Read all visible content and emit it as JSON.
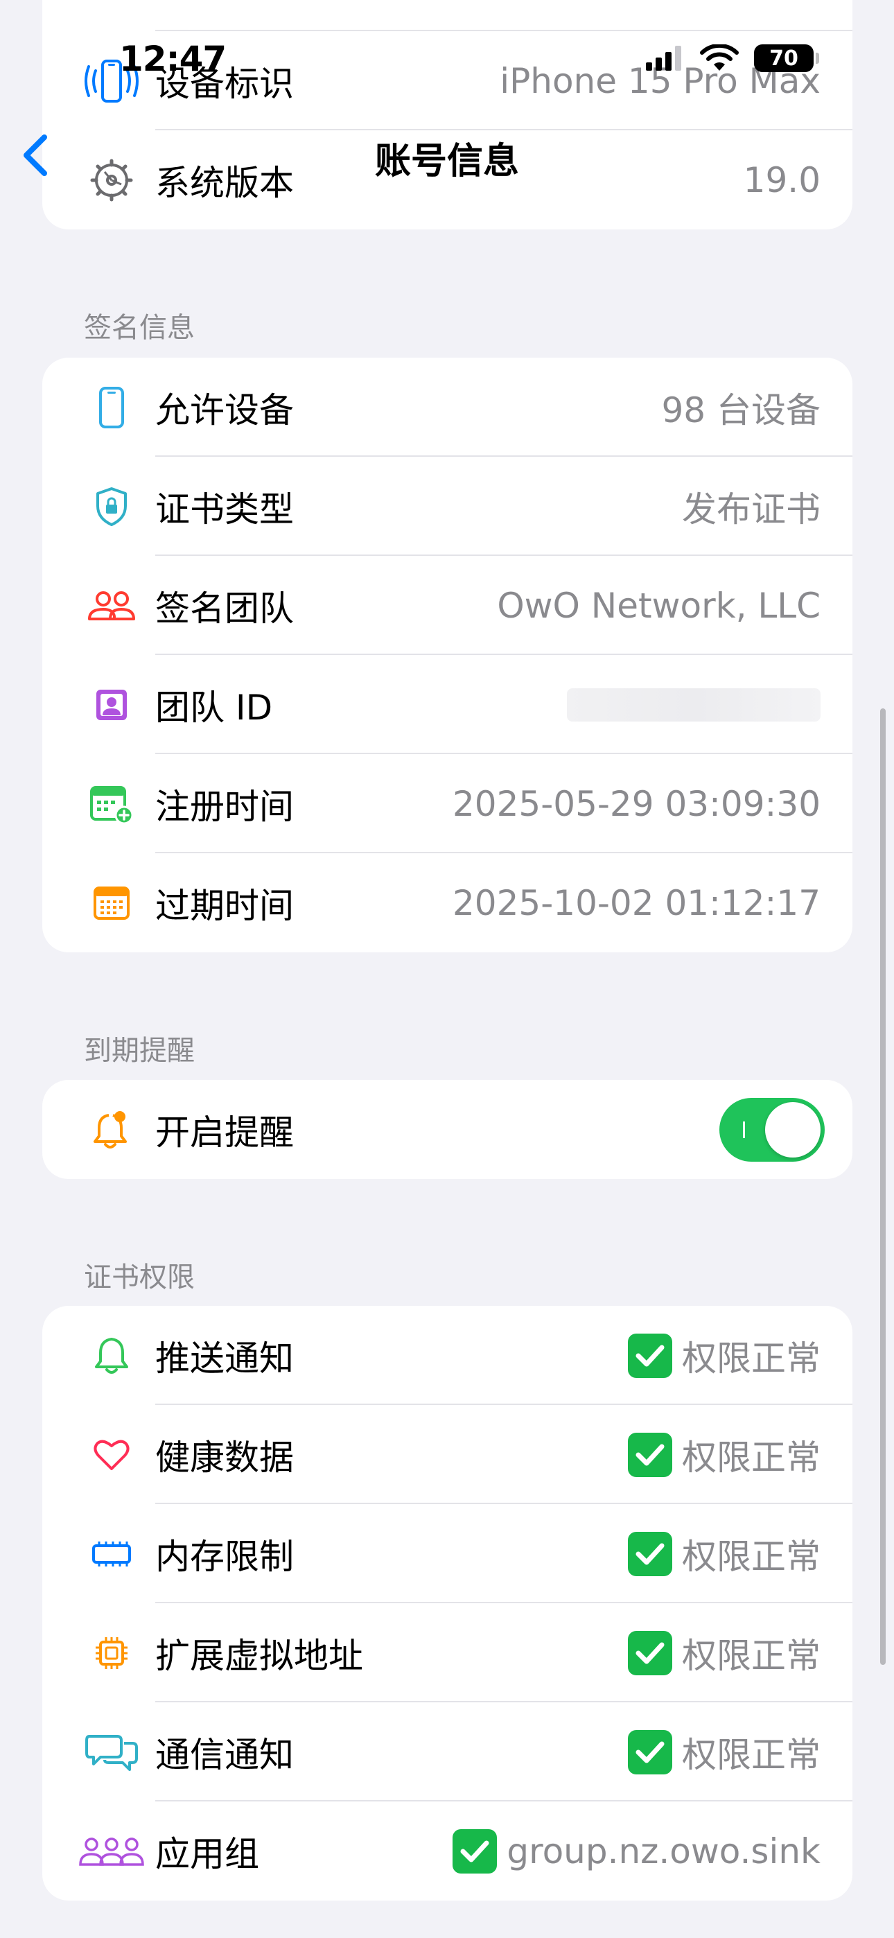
{
  "status_bar": {
    "time": "12:47",
    "battery": "70"
  },
  "nav": {
    "title": "账号信息"
  },
  "device_group": {
    "rows": [
      {
        "label": "设备标识",
        "value": "iPhone 15 Pro Max",
        "icon": "iphone-vibrate-icon"
      },
      {
        "label": "系统版本",
        "value": "19.0",
        "icon": "gear-icon"
      }
    ]
  },
  "signature": {
    "header": "签名信息",
    "rows": [
      {
        "label": "允许设备",
        "value": "98 台设备",
        "icon": "iphone-icon",
        "color": "#32ade6"
      },
      {
        "label": "证书类型",
        "value": "发布证书",
        "icon": "shield-lock-icon",
        "color": "#30b0c7"
      },
      {
        "label": "签名团队",
        "value": "OwO Network, LLC",
        "icon": "people-icon",
        "color": "#ff3b30"
      },
      {
        "label": "团队 ID",
        "value": "",
        "icon": "person-badge-icon",
        "color": "#af52de"
      },
      {
        "label": "注册时间",
        "value": "2025-05-29 03:09:30",
        "icon": "calendar-plus-icon",
        "color": "#34c759"
      },
      {
        "label": "过期时间",
        "value": "2025-10-02 01:12:17",
        "icon": "calendar-icon",
        "color": "#ff9500"
      }
    ]
  },
  "reminder": {
    "header": "到期提醒",
    "label": "开启提醒",
    "enabled": true,
    "icon": "bell-badge-icon"
  },
  "permissions": {
    "header": "证书权限",
    "rows": [
      {
        "label": "推送通知",
        "value": "权限正常",
        "icon": "bell-icon",
        "color": "#34c759"
      },
      {
        "label": "健康数据",
        "value": "权限正常",
        "icon": "heart-icon",
        "color": "#ff2d55"
      },
      {
        "label": "内存限制",
        "value": "权限正常",
        "icon": "memory-icon",
        "color": "#007aff"
      },
      {
        "label": "扩展虚拟地址",
        "value": "权限正常",
        "icon": "cpu-icon",
        "color": "#ff9500"
      },
      {
        "label": "通信通知",
        "value": "权限正常",
        "icon": "chat-bubbles-icon",
        "color": "#30b0c7"
      },
      {
        "label": "应用组",
        "value": "group.nz.owo.sink",
        "icon": "group-icon",
        "color": "#af52de"
      }
    ]
  }
}
